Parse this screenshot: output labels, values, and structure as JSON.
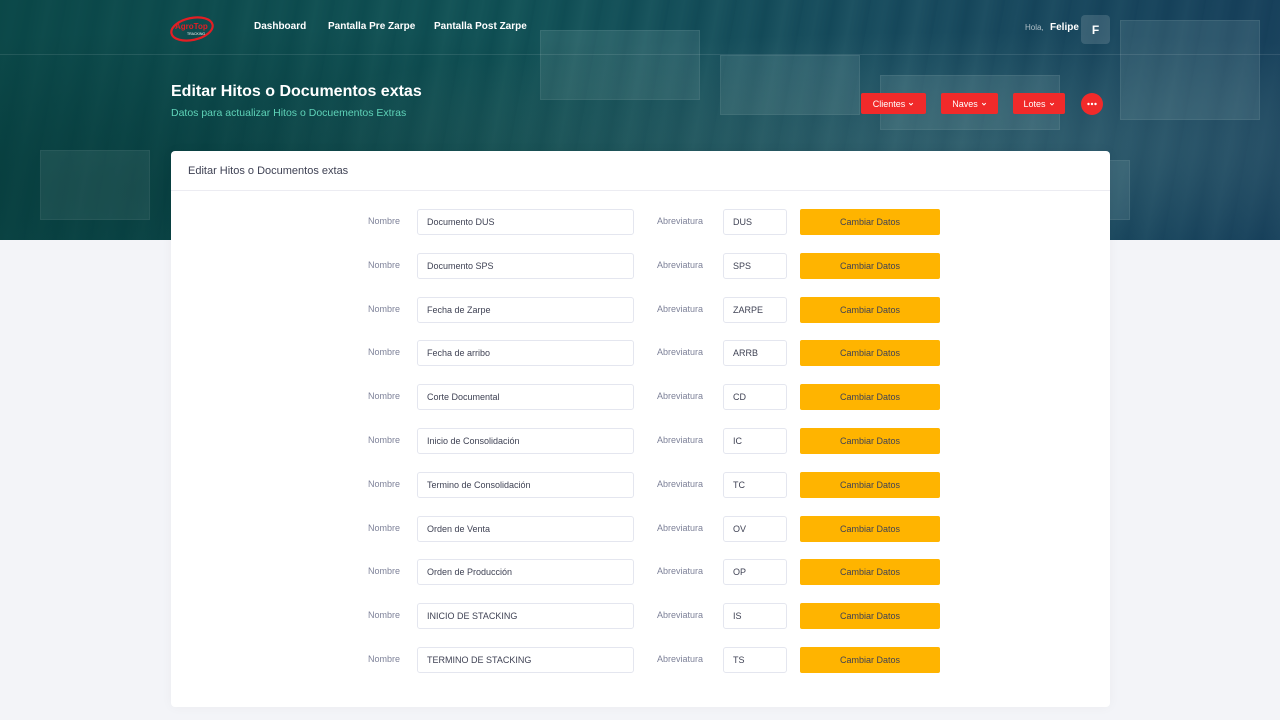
{
  "header": {
    "logo_text": "AgroTop",
    "logo_subtext": "TRACKING",
    "nav": [
      "Dashboard",
      "Pantalla Pre Zarpe",
      "Pantalla Post Zarpe"
    ],
    "greeting": "Hola,",
    "user_name": "Felipe",
    "avatar_initial": "F"
  },
  "subheader": {
    "title": "Editar Hitos o Documentos extas",
    "subtitle": "Datos para actualizar Hitos o Docuementos Extras",
    "buttons": [
      "Clientes",
      "Naves",
      "Lotes"
    ],
    "more_icon": "ellipsis-icon"
  },
  "card": {
    "title": "Editar Hitos o Documentos extas",
    "nombre_label": "Nombre",
    "abreviatura_label": "Abreviatura",
    "button_label": "Cambiar Datos",
    "rows": [
      {
        "nombre": "Documento DUS",
        "abreviatura": "DUS"
      },
      {
        "nombre": "Documento SPS",
        "abreviatura": "SPS"
      },
      {
        "nombre": "Fecha de Zarpe",
        "abreviatura": "ZARPE"
      },
      {
        "nombre": "Fecha de arribo",
        "abreviatura": "ARRB"
      },
      {
        "nombre": "Corte Documental",
        "abreviatura": "CD"
      },
      {
        "nombre": "Inicio de Consolidación",
        "abreviatura": "IC"
      },
      {
        "nombre": "Termino de Consolidación",
        "abreviatura": "TC"
      },
      {
        "nombre": "Orden de Venta",
        "abreviatura": "OV"
      },
      {
        "nombre": "Orden de Producción",
        "abreviatura": "OP"
      },
      {
        "nombre": "INICIO DE STACKING",
        "abreviatura": "IS"
      },
      {
        "nombre": "TERMINO DE STACKING",
        "abreviatura": "TS"
      }
    ]
  },
  "colors": {
    "accent_red": "#f12a2a",
    "button_yellow": "#ffb400",
    "subtitle_teal": "#5fd3b8"
  }
}
